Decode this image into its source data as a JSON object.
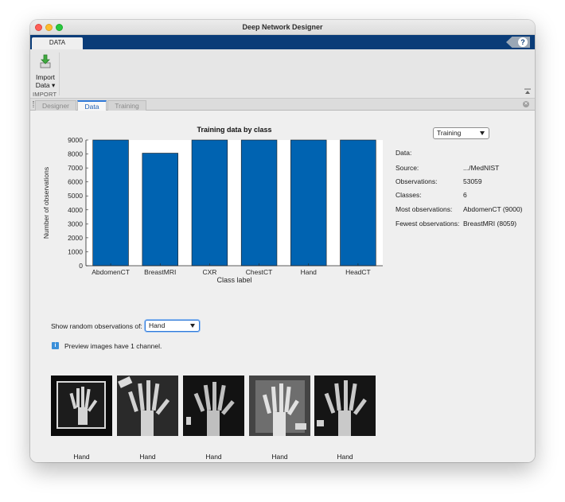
{
  "window": {
    "title": "Deep Network Designer"
  },
  "ribbon": {
    "tab": "DATA",
    "help_icon": "question-mark-icon",
    "import_button": {
      "line1": "Import",
      "line2": "Data ▾",
      "icon": "import-arrow-icon"
    },
    "section_label": "IMPORT"
  },
  "doc_tabs": [
    {
      "label": "Designer",
      "active": false
    },
    {
      "label": "Data",
      "active": true
    },
    {
      "label": "Training",
      "active": false
    }
  ],
  "chart_data": {
    "type": "bar",
    "title": "Training data by class",
    "xlabel": "Class label",
    "ylabel": "Number of observations",
    "categories": [
      "AbdomenCT",
      "BreastMRI",
      "CXR",
      "ChestCT",
      "Hand",
      "HeadCT"
    ],
    "values": [
      9000,
      8059,
      9000,
      9000,
      9000,
      9000
    ],
    "ylim": [
      0,
      9000
    ],
    "yticks": [
      "0",
      "1000",
      "2000",
      "3000",
      "4000",
      "5000",
      "6000",
      "7000",
      "8000",
      "9000"
    ],
    "grid": false,
    "bar_color": "#0063b1"
  },
  "info": {
    "data_label": "Data:",
    "data_value": "Training",
    "source_label": "Source:",
    "source_value": ".../MedNIST",
    "observations_label": "Observations:",
    "observations_value": "53059",
    "classes_label": "Classes:",
    "classes_value": "6",
    "most_label": "Most observations:",
    "most_value": "AbdomenCT (9000)",
    "fewest_label": "Fewest observations:",
    "fewest_value": "BreastMRI (8059)"
  },
  "preview": {
    "show_label": "Show random observations of:",
    "selected_class": "Hand",
    "note": "Preview images have 1 channel.",
    "note_icon": "info-icon",
    "images": [
      {
        "label": "Hand"
      },
      {
        "label": "Hand"
      },
      {
        "label": "Hand"
      },
      {
        "label": "Hand"
      },
      {
        "label": "Hand"
      }
    ]
  }
}
